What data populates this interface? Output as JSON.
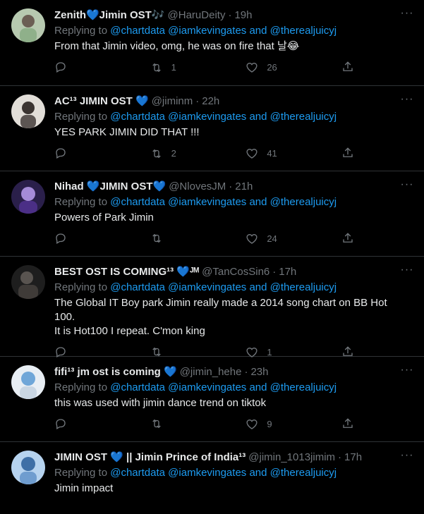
{
  "replying_to": "Replying to",
  "mentions": [
    "@chartdata",
    "@iamkevingates",
    "and",
    "@therealjuicyj"
  ],
  "tweets": [
    {
      "name": "Zenith💙Jimin OST🎶",
      "handle": "@HaruDeity",
      "time": "19h",
      "text": "From that Jimin video, omg, he was on fire that 날😂",
      "retweets": "1",
      "likes": "26",
      "avatar_color": "#9fb89a"
    },
    {
      "name": "AC¹³ JIMIN OST 💙",
      "handle": "@jiminm",
      "time": "22h",
      "text": "YES PARK JIMIN DID THAT !!!",
      "retweets": "2",
      "likes": "41",
      "avatar_color": "#d8d4cf"
    },
    {
      "name": "Nihad 💙JIMIN OST💙",
      "handle": "@NlovesJM",
      "time": "21h",
      "text": "Powers of Park Jimin",
      "retweets": "",
      "likes": "24",
      "avatar_color": "#5a3f8f"
    },
    {
      "name": "BEST OST IS COMING¹³ 💙ᴶᴹ",
      "handle": "@TanCosSin6",
      "time": "17h",
      "text": "The Global IT Boy park Jimin really made a 2014 song chart on BB Hot 100.\nIt is Hot100 I repeat. C'mon king",
      "retweets": "",
      "likes": "1",
      "avatar_color": "#3a3a3a"
    },
    {
      "name": "fifi¹³ jm ost is coming 💙",
      "handle": "@jimin_hehe",
      "time": "23h",
      "text": "this was used with jimin dance trend on tiktok",
      "retweets": "",
      "likes": "9",
      "avatar_color": "#dfe9f2"
    },
    {
      "name": "JIMIN OST 💙 || Jimin Prince of India¹³",
      "handle": "@jimin_1013jimim",
      "time": "17h",
      "text": "Jimin impact",
      "retweets": "",
      "likes": "",
      "avatar_color": "#a9c9e8"
    }
  ],
  "more_label": "···",
  "colors": {
    "background": "#000000",
    "accent": "#1d9bf0",
    "muted": "#71767b",
    "border": "#2f3336"
  },
  "icons": [
    "reply-icon",
    "retweet-icon",
    "like-icon",
    "share-icon",
    "more-icon"
  ]
}
